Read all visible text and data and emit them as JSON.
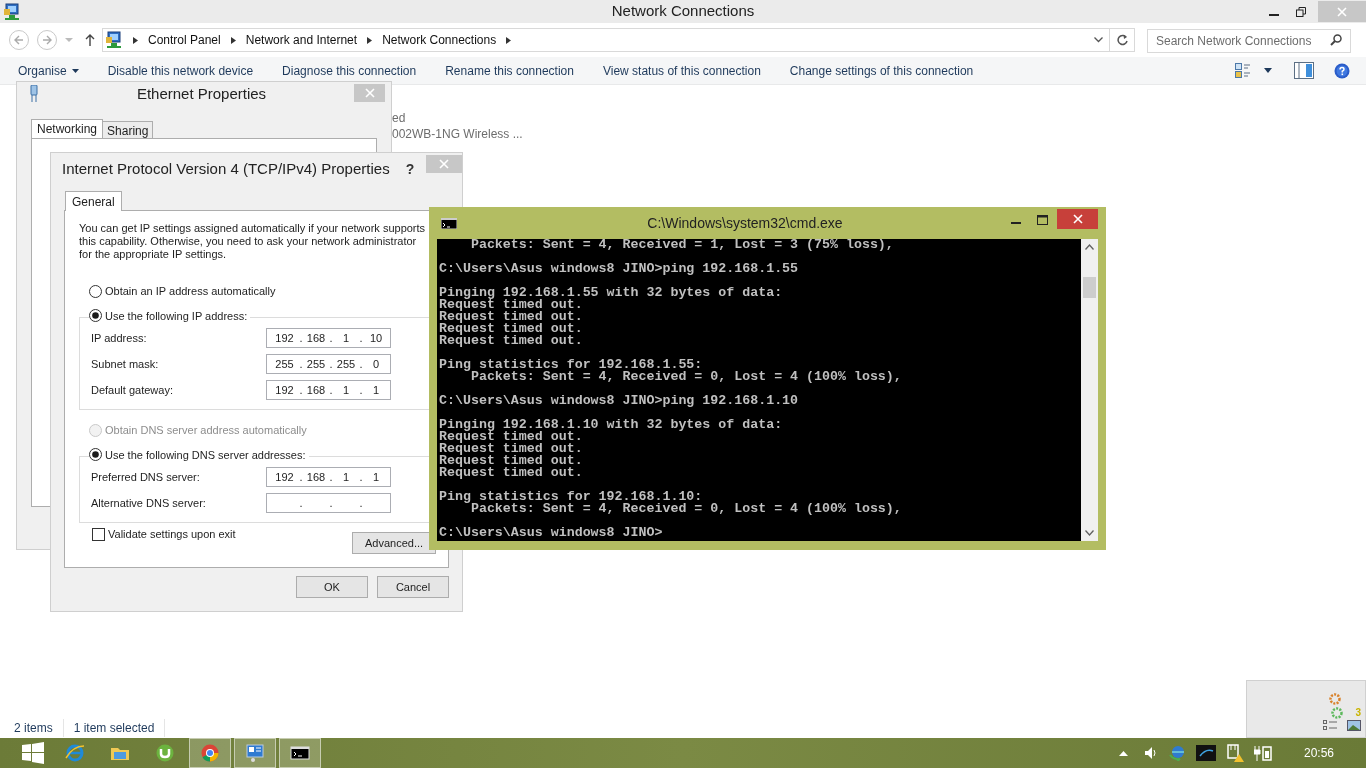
{
  "explorer": {
    "title": "Network Connections",
    "breadcrumb": [
      "Control Panel",
      "Network and Internet",
      "Network Connections"
    ],
    "search": {
      "placeholder": "Search Network Connections"
    },
    "commands": [
      {
        "label": "Organise",
        "has_menu": true
      },
      {
        "label": "Disable this network device",
        "has_menu": false
      },
      {
        "label": "Diagnose this connection",
        "has_menu": false
      },
      {
        "label": "Rename this connection",
        "has_menu": false
      },
      {
        "label": "View status of this connection",
        "has_menu": false
      },
      {
        "label": "Change settings of this connection",
        "has_menu": false
      }
    ],
    "item_fragments": [
      "ed",
      "002WB-1NG Wireless ..."
    ],
    "status_bar": [
      "2 items",
      "1 item selected"
    ]
  },
  "ethernet_dialog": {
    "title": "Ethernet Properties",
    "tabs": [
      {
        "label": "Networking",
        "selected": true
      },
      {
        "label": "Sharing",
        "selected": false
      }
    ]
  },
  "ipv4_dialog": {
    "title": "Internet Protocol Version 4 (TCP/IPv4) Properties",
    "help": "?",
    "separator": ".",
    "tabs": [
      {
        "label": "General",
        "selected": true
      }
    ],
    "description": "You can get IP settings assigned automatically if your network supports this capability. Otherwise, you need to ask your network administrator for the appropriate IP settings.",
    "ip_options": [
      {
        "label": "Obtain an IP address automatically",
        "selected": false,
        "disabled": false
      },
      {
        "label": "Use the following IP address:",
        "selected": true,
        "disabled": false
      }
    ],
    "ip_fields": [
      {
        "label": "IP address:",
        "octets": [
          "192",
          "168",
          "1",
          "10"
        ]
      },
      {
        "label": "Subnet mask:",
        "octets": [
          "255",
          "255",
          "255",
          "0"
        ]
      },
      {
        "label": "Default gateway:",
        "octets": [
          "192",
          "168",
          "1",
          "1"
        ]
      }
    ],
    "dns_options": [
      {
        "label": "Obtain DNS server address automatically",
        "selected": false,
        "disabled": true
      },
      {
        "label": "Use the following DNS server addresses:",
        "selected": true,
        "disabled": false
      }
    ],
    "dns_fields": [
      {
        "label": "Preferred DNS server:",
        "octets": [
          "192",
          "168",
          "1",
          "1"
        ]
      },
      {
        "label": "Alternative DNS server:"
      }
    ],
    "validate": {
      "label": "Validate settings upon exit",
      "checked": false
    },
    "advanced_button": "Advanced...",
    "buttons": [
      "OK",
      "Cancel"
    ]
  },
  "cmd": {
    "title": "C:\\Windows\\system32\\cmd.exe",
    "blocks": [
      [
        "    Packets: Sent = 4, Received = 1, Lost = 3 (75% loss),"
      ],
      [
        "C:\\Users\\Asus windows8 JINO>ping 192.168.1.55"
      ],
      [
        "Pinging 192.168.1.55 with 32 bytes of data:",
        "Request timed out.",
        "Request timed out.",
        "Request timed out.",
        "Request timed out."
      ],
      [
        "Ping statistics for 192.168.1.55:",
        "    Packets: Sent = 4, Received = 0, Lost = 4 (100% loss),"
      ],
      [
        "C:\\Users\\Asus windows8 JINO>ping 192.168.1.10"
      ],
      [
        "Pinging 192.168.1.10 with 32 bytes of data:",
        "Request timed out.",
        "Request timed out.",
        "Request timed out.",
        "Request timed out."
      ],
      [
        "Ping statistics for 192.168.1.10:",
        "    Packets: Sent = 4, Received = 0, Lost = 4 (100% loss),"
      ],
      [
        "C:\\Users\\Asus windows8 JINO>"
      ]
    ]
  },
  "widget": {
    "count": "3"
  },
  "taskbar": {
    "apps": [
      {
        "kind": "browser",
        "running": false
      },
      {
        "kind": "folder",
        "running": false
      },
      {
        "kind": "torrent",
        "running": false
      },
      {
        "kind": "chrome",
        "running": true
      },
      {
        "kind": "monitor",
        "running": true
      },
      {
        "kind": "terminal",
        "running": true
      }
    ],
    "clock": "20:56"
  }
}
